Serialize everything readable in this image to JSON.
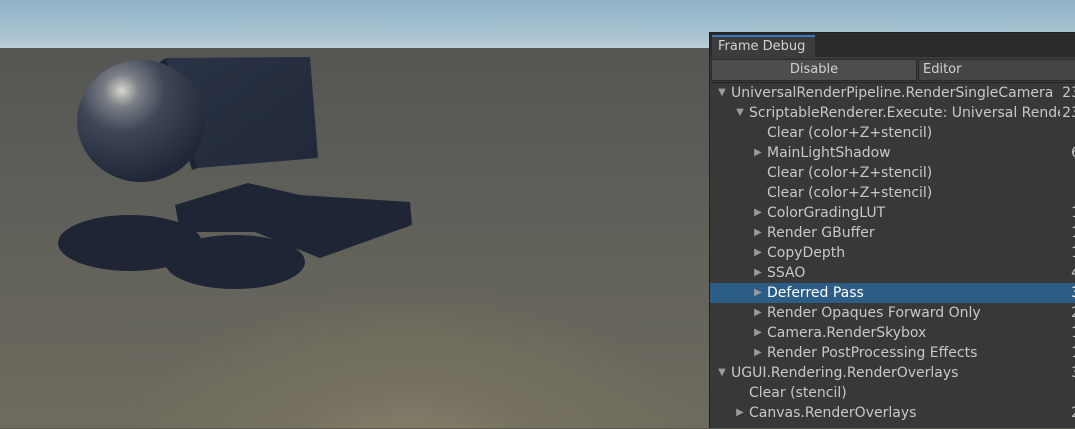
{
  "panel": {
    "tab_title": "Frame Debug",
    "disable_label": "Disable",
    "target_label": "Editor"
  },
  "tree": [
    {
      "label": "UniversalRenderPipeline.RenderSingleCamera",
      "count": "23",
      "level": 0,
      "expander": "expanded"
    },
    {
      "label": "ScriptableRenderer.Execute: Universal Renderer",
      "count": "23",
      "level": 1,
      "expander": "expanded"
    },
    {
      "label": "Clear (color+Z+stencil)",
      "count": "",
      "level": 2,
      "expander": "none"
    },
    {
      "label": "MainLightShadow",
      "count": "6",
      "level": 2,
      "expander": "collapsed"
    },
    {
      "label": "Clear (color+Z+stencil)",
      "count": "",
      "level": 2,
      "expander": "none"
    },
    {
      "label": "Clear (color+Z+stencil)",
      "count": "",
      "level": 2,
      "expander": "none"
    },
    {
      "label": "ColorGradingLUT",
      "count": "1",
      "level": 2,
      "expander": "collapsed"
    },
    {
      "label": "Render GBuffer",
      "count": "1",
      "level": 2,
      "expander": "collapsed"
    },
    {
      "label": "CopyDepth",
      "count": "1",
      "level": 2,
      "expander": "collapsed"
    },
    {
      "label": "SSAO",
      "count": "4",
      "level": 2,
      "expander": "collapsed"
    },
    {
      "label": "Deferred Pass",
      "count": "3",
      "level": 2,
      "expander": "collapsed",
      "selected": true
    },
    {
      "label": "Render Opaques Forward Only",
      "count": "2",
      "level": 2,
      "expander": "collapsed"
    },
    {
      "label": "Camera.RenderSkybox",
      "count": "1",
      "level": 2,
      "expander": "collapsed"
    },
    {
      "label": "Render PostProcessing Effects",
      "count": "1",
      "level": 2,
      "expander": "collapsed"
    },
    {
      "label": "UGUI.Rendering.RenderOverlays",
      "count": "3",
      "level": 0,
      "expander": "expanded"
    },
    {
      "label": "Clear (stencil)",
      "count": "",
      "level": 1,
      "expander": "none"
    },
    {
      "label": "Canvas.RenderOverlays",
      "count": "2",
      "level": 1,
      "expander": "collapsed"
    }
  ],
  "icons": {
    "expanded": "▼",
    "collapsed": "▶"
  },
  "colors": {
    "selection": "#2c5d87",
    "panel_bg": "#383838",
    "tab_accent": "#3a79bb"
  }
}
